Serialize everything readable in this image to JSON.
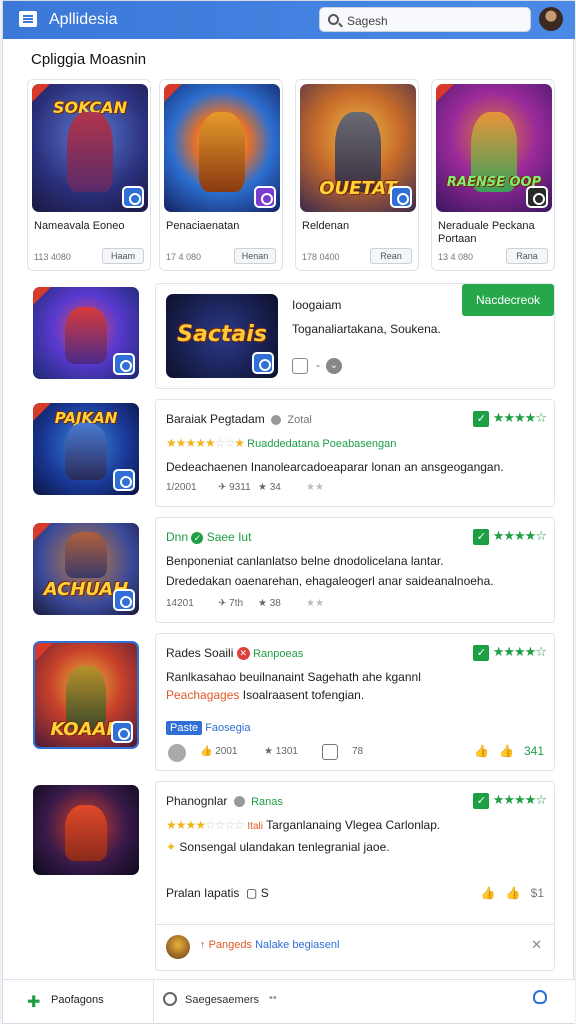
{
  "header": {
    "app_title": "Apllidesia",
    "search_placeholder": "Sagesh"
  },
  "section_title": "Cpliggia Moasnin",
  "top_cards": [
    {
      "art_text": "SOKCAN",
      "name": "Nameavala Eoneo",
      "count": "113 4080",
      "button": "Haam"
    },
    {
      "art_text": "",
      "name": "Penaciaenatan",
      "count": "17 4 080",
      "button": "Henan"
    },
    {
      "art_text": "OUETAT",
      "name": "Reldenan",
      "count": "178 0400",
      "button": "Rean"
    },
    {
      "art_text": "RAENSE OOP",
      "name": "Neraduale Peckana Portaan",
      "count": "13 4 080",
      "button": "Rana"
    }
  ],
  "featured": {
    "art_text": "Sactais",
    "title": "Ioogaiam",
    "desc": "Toganaliartakana, Soukena.",
    "button": "Nacdecreok"
  },
  "reviews": [
    {
      "art_text": "PAJKAN",
      "title": "Baraiak Pegtadam",
      "tag": "Zotal",
      "rating_text": "Ruaddedatana Poeabasengan",
      "stars_filled": 5,
      "green_stars": 4,
      "body": "Dedeachaenen Inanolearcadoeaparar lonan an ansgeogangan.",
      "stat1": "1/2001",
      "stat2": "9311",
      "stat3": "34",
      "icon_text": ""
    },
    {
      "art_text": "ACHUAH",
      "title": "Dnn",
      "tag": "Saee Iut",
      "body": "Benponeniat canlanlatso belne dnodolicelana lantar.",
      "body2": "Drededakan oaenarehan, ehagaleogerl anar saideanalnoeha.",
      "stat1": "14201",
      "stat2": "7th",
      "stat3": "38",
      "green_stars": 4
    },
    {
      "art_text": "KOAAH",
      "title": "Rades Soaili",
      "tag": "Ranpoeas",
      "body": "Ranlkasahao beuilnanaint Sagehath ahe kgannl",
      "body_red": "Peachagages",
      "body2": "Isoalraasent tofengian.",
      "pill_label": "Paste",
      "pill_text": "Faosegia",
      "stat1": "2001",
      "stat2": "1301",
      "stat3": "78",
      "like": "341",
      "green_stars": 4
    },
    {
      "title": "Phanognlar",
      "tag": "Ranas",
      "stars_filled": 4,
      "rating_mid": "Itali",
      "rating_text": "Targanlanaing Vlegea Carlonlap.",
      "body": "Sonsengal ulandakan tenlegranial jaoe.",
      "footer_label": "Pralan Iapatis",
      "footer_s": "S",
      "like": "$1",
      "green_stars": 4
    }
  ],
  "comment_bar": {
    "orange": "Pangeds",
    "blue": "Nalake begiasenl"
  },
  "bottom": {
    "left_label": "Paofagons",
    "middle_label": "Saegesaemers"
  }
}
